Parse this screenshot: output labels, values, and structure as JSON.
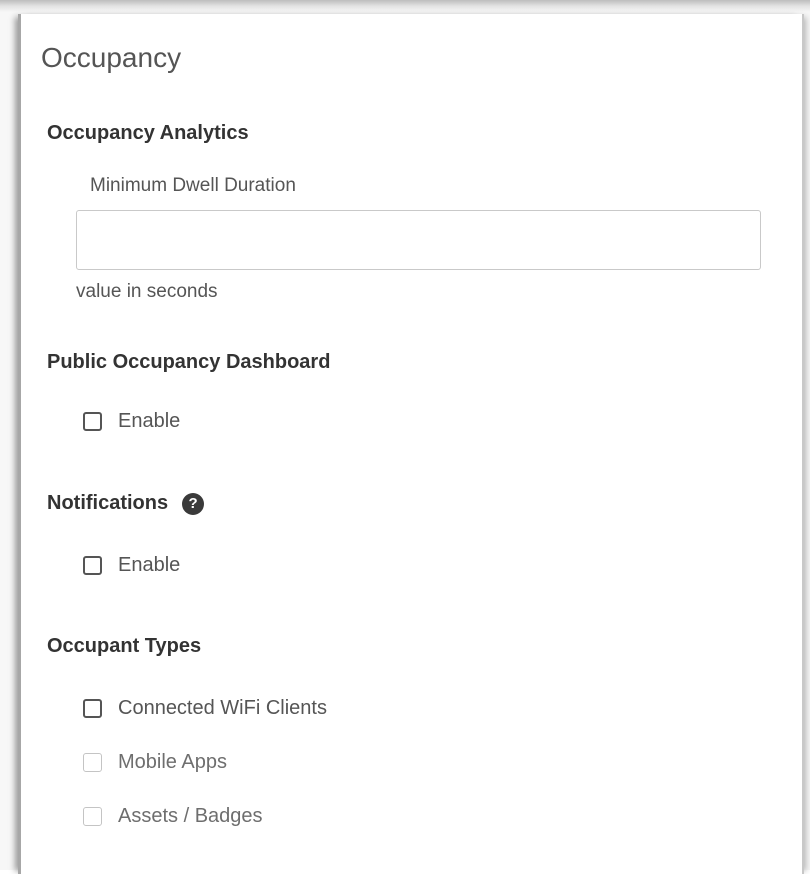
{
  "page": {
    "title": "Occupancy"
  },
  "occupancy_analytics": {
    "heading": "Occupancy Analytics",
    "dwell_label": "Minimum Dwell Duration",
    "dwell_value": "",
    "dwell_placeholder": "",
    "dwell_helper": "value in seconds"
  },
  "public_dashboard": {
    "heading": "Public Occupancy Dashboard",
    "enable_label": "Enable",
    "enabled": false
  },
  "notifications": {
    "heading": "Notifications",
    "help_icon": "question-circle-icon",
    "help_glyph": "?",
    "enable_label": "Enable",
    "enabled": false
  },
  "occupant_types": {
    "heading": "Occupant Types",
    "items": [
      {
        "label": "Connected WiFi Clients",
        "checked": false,
        "disabled": false
      },
      {
        "label": "Mobile Apps",
        "checked": false,
        "disabled": true
      },
      {
        "label": "Assets / Badges",
        "checked": false,
        "disabled": true
      }
    ]
  }
}
